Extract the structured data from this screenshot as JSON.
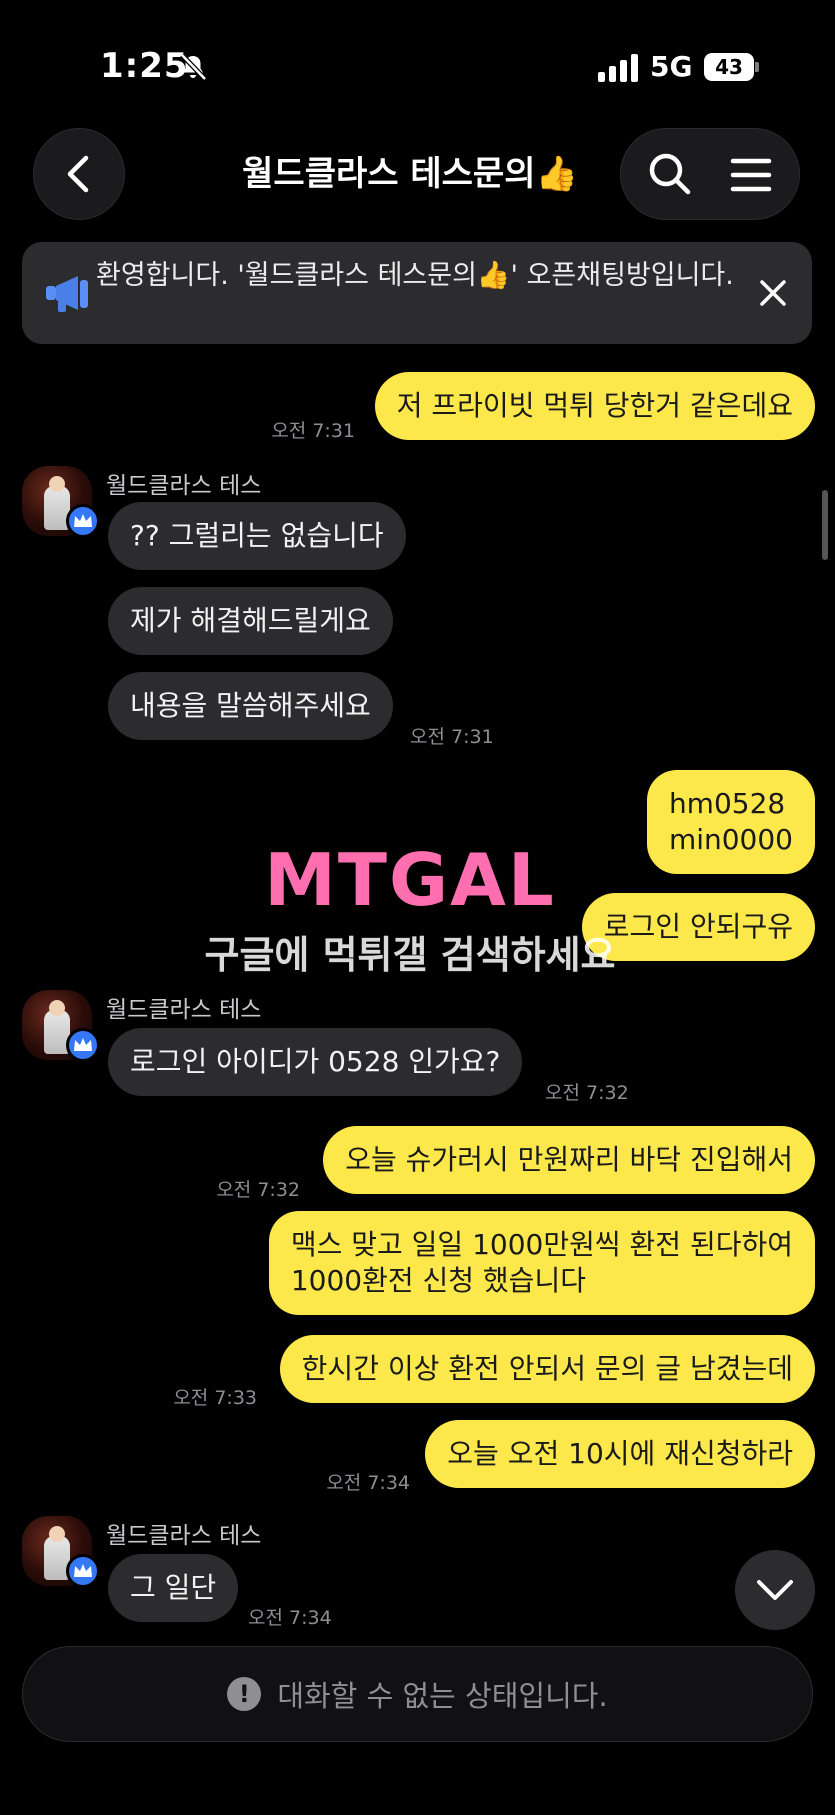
{
  "status_bar": {
    "time": "1:25",
    "network": "5G",
    "battery": "43"
  },
  "header": {
    "title": "월드클라스 테스문의👍"
  },
  "notice": {
    "text": "환영합니다. '월드클라스 테스문의👍' 오픈채팅방입니다."
  },
  "sender_name": "월드클라스 테스",
  "messages": [
    {
      "text": "저 프라이빗 먹튀 당한거 같은데요",
      "time": "오전 7:31"
    },
    {
      "text": "?? 그럴리는 없습니다"
    },
    {
      "text": "제가 해결해드릴게요"
    },
    {
      "text": "내용을 말씀해주세요",
      "time": "오전 7:31"
    },
    {
      "line1": "hm0528",
      "line2": "min0000"
    },
    {
      "text": "로그인 안되구유"
    },
    {
      "text": "로그인 아이디가 0528 인가요?",
      "time": "오전 7:32"
    },
    {
      "text": "오늘 슈가러시 만원짜리 바닥 진입해서",
      "time": "오전 7:32"
    },
    {
      "line1": "맥스 맞고 일일 1000만원씩 환전 된다하여",
      "line2": "1000환전 신청 했습니다"
    },
    {
      "text": "한시간 이상 환전 안되서 문의 글 남겼는데",
      "time": "오전 7:33"
    },
    {
      "text": "오늘 오전 10시에 재신청하라",
      "time": "오전 7:34"
    },
    {
      "text": "그 일단",
      "time": "오전 7:34"
    }
  ],
  "watermark": {
    "logo": "MTGAL",
    "text": "구글에 먹튀갤 검색하세요"
  },
  "input_bar": {
    "text": "대화할 수 없는 상태입니다."
  },
  "colors": {
    "my_bubble": "#fde84c",
    "their_bubble": "#2c2c2e",
    "badge": "#3478f6"
  },
  "icons": [
    "back-icon",
    "search-icon",
    "menu-icon",
    "megaphone-icon",
    "close-icon",
    "crown-icon",
    "chevron-down-icon",
    "exclamation-icon",
    "bell-slash-icon",
    "signal-icon"
  ]
}
